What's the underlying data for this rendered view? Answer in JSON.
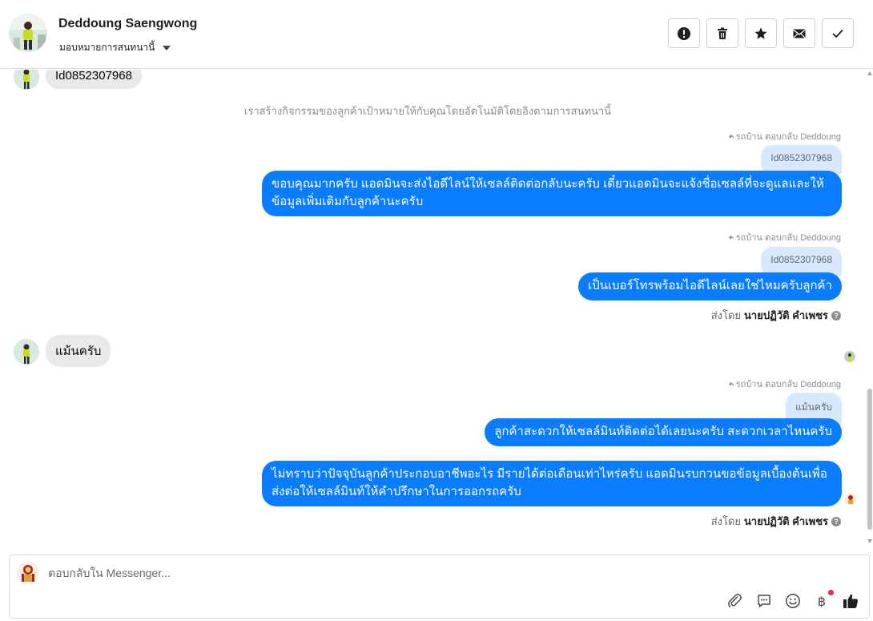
{
  "header": {
    "contact_name": "Deddoung Saengwong",
    "assign_label": "มอบหมายการสนทนานี้",
    "actions": [
      {
        "name": "mark-spam-button",
        "icon": "alert-icon"
      },
      {
        "name": "delete-button",
        "icon": "trash-icon"
      },
      {
        "name": "star-button",
        "icon": "star-icon"
      },
      {
        "name": "mark-unread-button",
        "icon": "envelope-icon"
      },
      {
        "name": "mark-done-button",
        "icon": "check-icon"
      }
    ]
  },
  "thread": {
    "msg_in_1": "Id0852307968",
    "system_note": "เราสร้างกิจกรรมของลูกค้าเป้าหมายให้กับคุณโดยอัตโนมัติโดยอิงตามการสนทนานี้",
    "reply_hint_1": "รถบ้าน ตอบกลับ Deddoung",
    "quote_1": "Id0852307968",
    "msg_out_1": "ขอบคุณมากครับ แอดมินจะส่งไอดีไลน์ให้เซลล์ติดต่อกลับนะครับ เดี๋ยวแอดมินจะแจ้งชื่อเซลล์ที่จะดูแลและให้ข้อมูลเพิ่มเติมกับลูกค้านะครับ",
    "reply_hint_2": "รถบ้าน ตอบกลับ Deddoung",
    "quote_2": "Id0852307968",
    "msg_out_2": "เป็นเบอร์โทรพร้อมไอดีไลน์เลยใช่ไหมครับลูกค้า",
    "sent_by_label_1": "ส่งโดย",
    "sent_by_name_1": "นายปฏิวัติ คำเพชร",
    "msg_in_2": "แม้นครับ",
    "reply_hint_3": "รถบ้าน ตอบกลับ Deddoung",
    "quote_3": "แม้นครับ",
    "msg_out_3": "ลูกค้าสะดวกให้เซลล์มินท์ติดต่อได้เลยนะครับ สะดวกเวลาไหนครับ",
    "msg_out_4": "ไม่ทราบว่าปัจจุบันลูกค้าประกอบอาชีพอะไร มีรายได้ต่อเดือนเท่าไหร่ครับ แอดมินรบกวนขอข้อมูลเบื้องต้นเพื่อส่งต่อให้เซลล์มินท์ให้คำปรึกษาในการออกรถครับ",
    "sent_by_label_2": "ส่งโดย",
    "sent_by_name_2": "นายปฏิวัติ คำเพชร"
  },
  "composer": {
    "placeholder": "ตอบกลับใน Messenger...",
    "tools": [
      "paperclip-icon",
      "saved-reply-icon",
      "emoji-icon",
      "baht-payment-icon",
      "thumbs-up-icon"
    ]
  },
  "colors": {
    "outgoing_bubble": "#0a7cff",
    "incoming_bubble": "#e9e9eb",
    "quote_bubble": "#d7e8ff",
    "notification_dot": "#f02849"
  }
}
